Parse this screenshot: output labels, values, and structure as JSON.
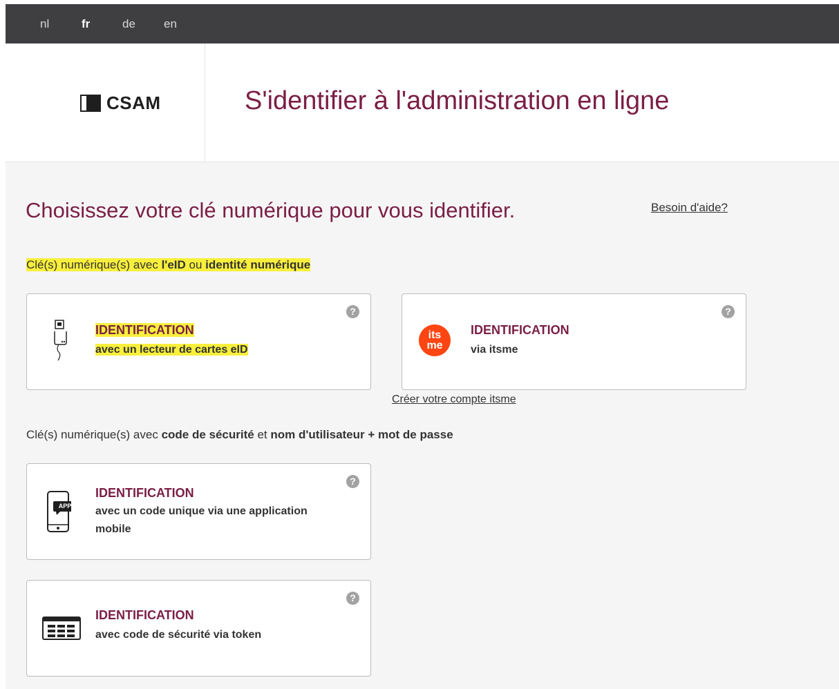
{
  "languages": [
    {
      "code": "nl",
      "active": false
    },
    {
      "code": "fr",
      "active": true
    },
    {
      "code": "de",
      "active": false
    },
    {
      "code": "en",
      "active": false
    }
  ],
  "logo": {
    "text": "CSAM"
  },
  "site_title": "S'identifier à l'administration en ligne",
  "heading": "Choisissez votre clé numérique pour vous identifier.",
  "help_link": "Besoin d'aide?",
  "section1": {
    "prefix": "Clé(s) numérique(s) avec ",
    "bold1": "l'eID",
    "middle": " ou ",
    "bold2": "identité numérique"
  },
  "section2": {
    "prefix": "Clé(s) numérique(s) avec ",
    "bold1": "code de sécurité",
    "middle": " et ",
    "bold2": "nom d'utilisateur + mot de passe"
  },
  "cards": [
    {
      "title": "IDENTIFICATION",
      "subtitle": "avec un lecteur de cartes eID",
      "icon": "eid-card-reader-icon"
    },
    {
      "title": "IDENTIFICATION",
      "subtitle": "via itsme",
      "icon": "itsme-logo-icon",
      "icon_text_top": "its",
      "icon_text_bottom": "me"
    },
    {
      "title": "IDENTIFICATION",
      "subtitle": "avec un code unique via une application mobile",
      "icon": "mobile-app-icon",
      "icon_badge": "APP"
    },
    {
      "title": "IDENTIFICATION",
      "subtitle": "avec code de sécurité via token",
      "icon": "token-icon"
    }
  ],
  "help_icon_glyph": "?",
  "itsme_account_link": "Créer votre compte itsme",
  "colors": {
    "topbar": "#3f3f41",
    "brand_burgundy": "#7a1e45",
    "itsme_orange": "#ff4612",
    "highlight": "#f8ef3c",
    "background": "#f5f5f5"
  }
}
